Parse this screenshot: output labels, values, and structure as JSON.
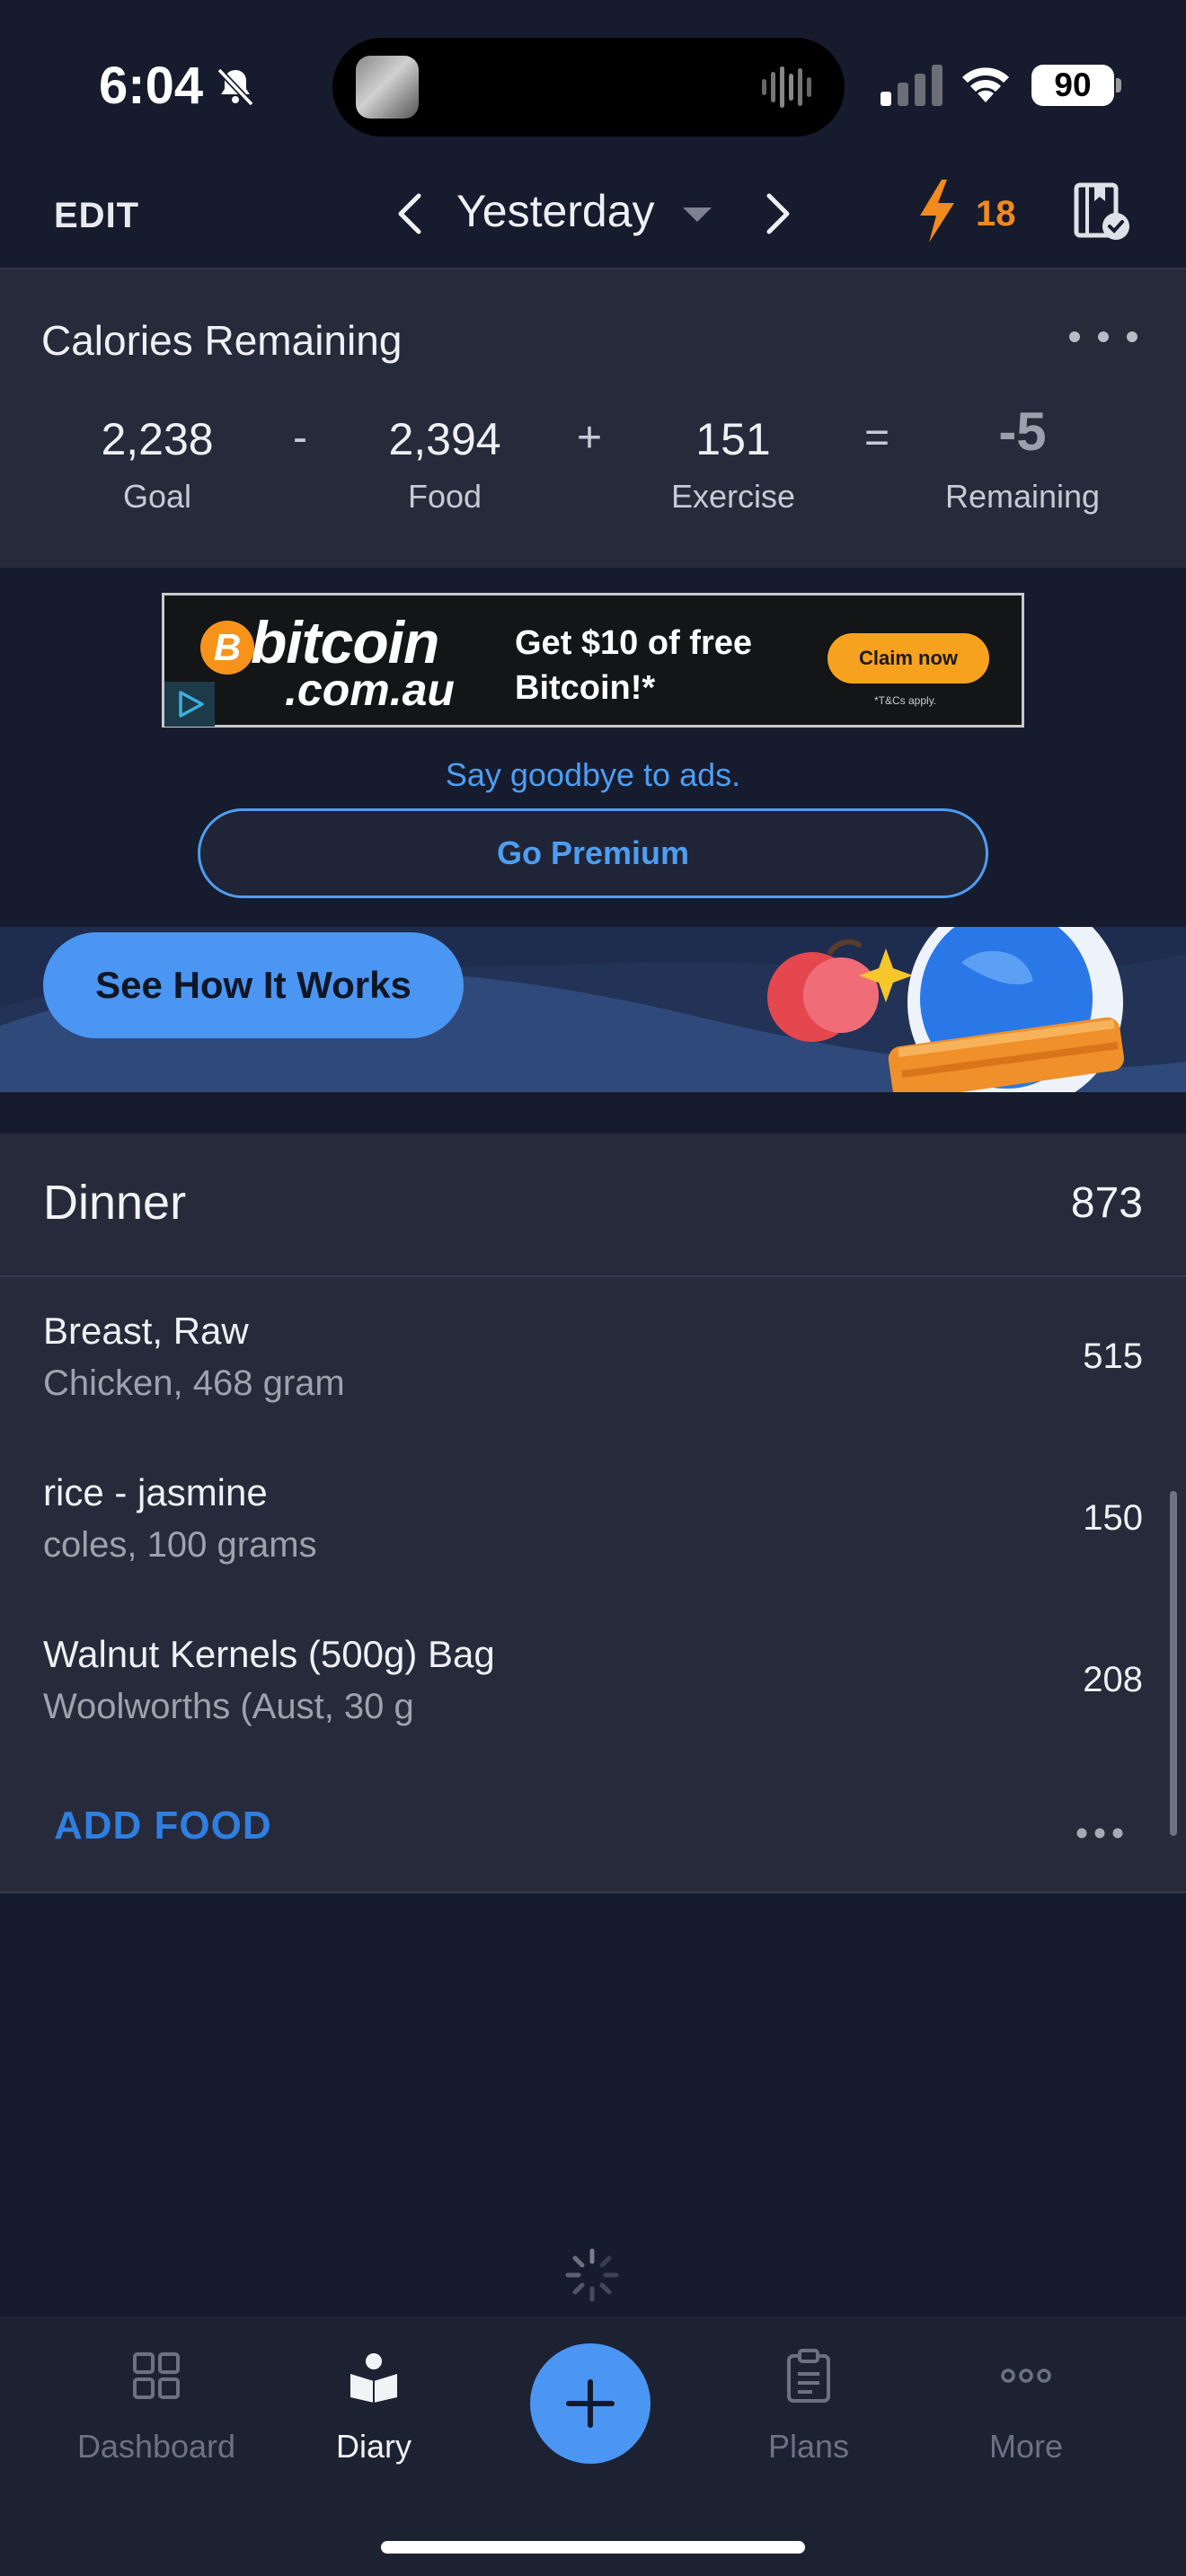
{
  "status_bar": {
    "time": "6:04",
    "battery": "90"
  },
  "header": {
    "edit_label": "EDIT",
    "date_label": "Yesterday",
    "streak_count": "18",
    "accent_color": "#f28a1c"
  },
  "calories": {
    "title": "Calories Remaining",
    "goal_value": "2,238",
    "goal_label": "Goal",
    "minus_op": "-",
    "food_value": "2,394",
    "food_label": "Food",
    "plus_op": "+",
    "exercise_value": "151",
    "exercise_label": "Exercise",
    "equals_op": "=",
    "remaining_value": "-5",
    "remaining_label": "Remaining"
  },
  "ad": {
    "coin_symbol": "B",
    "brand": "bitcoin",
    "brand_suffix": ".com.au",
    "headline": "Get $10 of free Bitcoin!*",
    "cta": "Claim now",
    "terms": "*T&Cs apply.",
    "goodbye_text": "Say goodbye to ads.",
    "premium_button": "Go Premium"
  },
  "promo": {
    "button": "See How It Works"
  },
  "meal": {
    "title": "Dinner",
    "total": "873",
    "items": [
      {
        "name": "Breast, Raw",
        "detail": "Chicken, 468 gram",
        "calories": "515"
      },
      {
        "name": "rice - jasmine",
        "detail": "coles, 100 grams",
        "calories": "150"
      },
      {
        "name": "Walnut Kernels (500g) Bag",
        "detail": "Woolworths (Aust, 30 g",
        "calories": "208"
      }
    ],
    "add_food": "ADD FOOD"
  },
  "tab_bar": {
    "tabs": [
      {
        "label": "Dashboard",
        "icon": "dashboard-grid-icon"
      },
      {
        "label": "Diary",
        "icon": "diary-book-icon"
      },
      {
        "label": "Plans",
        "icon": "clipboard-icon"
      },
      {
        "label": "More",
        "icon": "more-dots-icon"
      }
    ],
    "active_tab": "Diary",
    "fab_icon": "plus-icon",
    "primary_color": "#4a96f2"
  }
}
